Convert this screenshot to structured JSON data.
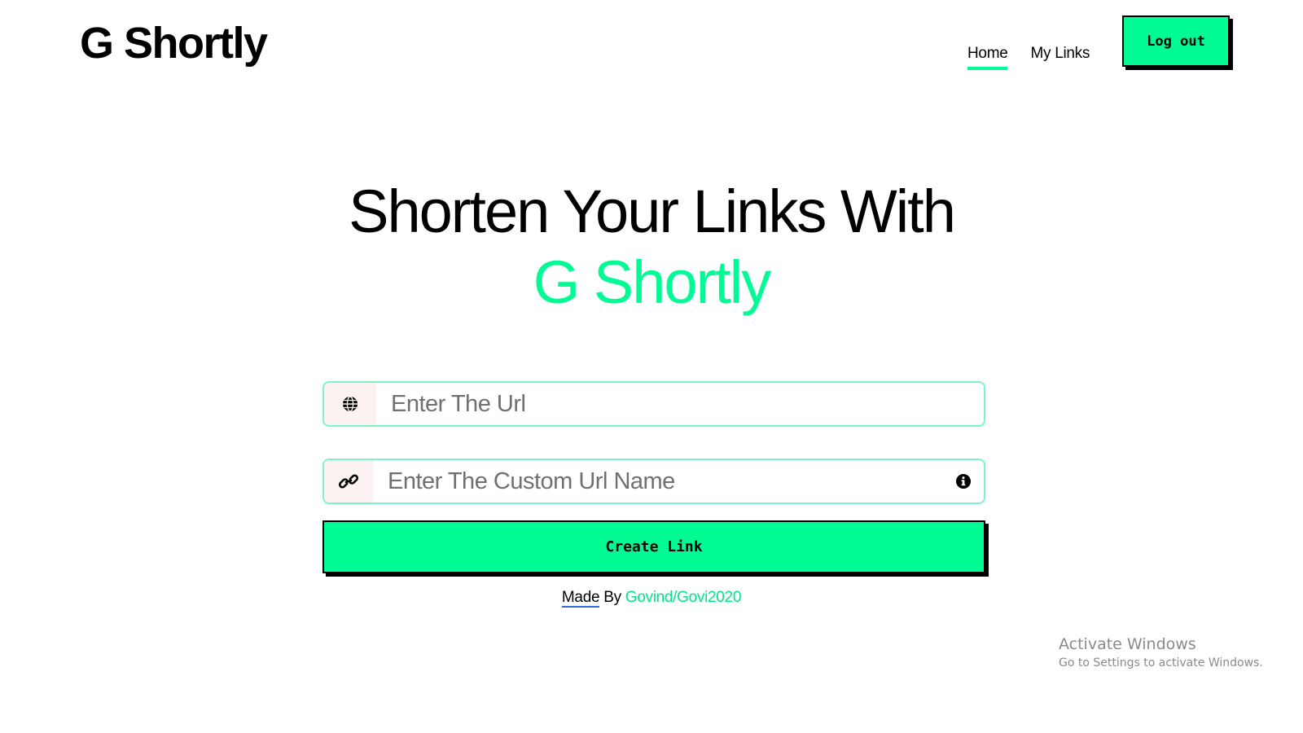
{
  "header": {
    "logo": "G Shortly",
    "nav": [
      {
        "label": "Home",
        "active": true
      },
      {
        "label": "My Links",
        "active": false
      }
    ],
    "logout_label": "Log out"
  },
  "hero": {
    "line1": "Shorten Your Links With",
    "line2": "G Shortly"
  },
  "form": {
    "url_placeholder": "Enter The Url",
    "url_icon": "globe-icon",
    "custom_placeholder": "Enter The Custom Url Name",
    "custom_icon": "link-icon",
    "info_icon": "info-icon",
    "create_label": "Create Link"
  },
  "footer": {
    "made": "Made",
    "by": " By ",
    "author": "Govind/Govi2020"
  },
  "watermark": {
    "title": "Activate Windows",
    "subtitle": "Go to Settings to activate Windows."
  },
  "colors": {
    "accent": "#00fb95",
    "field_border": "#7cf5c6",
    "prefix_bg": "#fbf2f1"
  }
}
